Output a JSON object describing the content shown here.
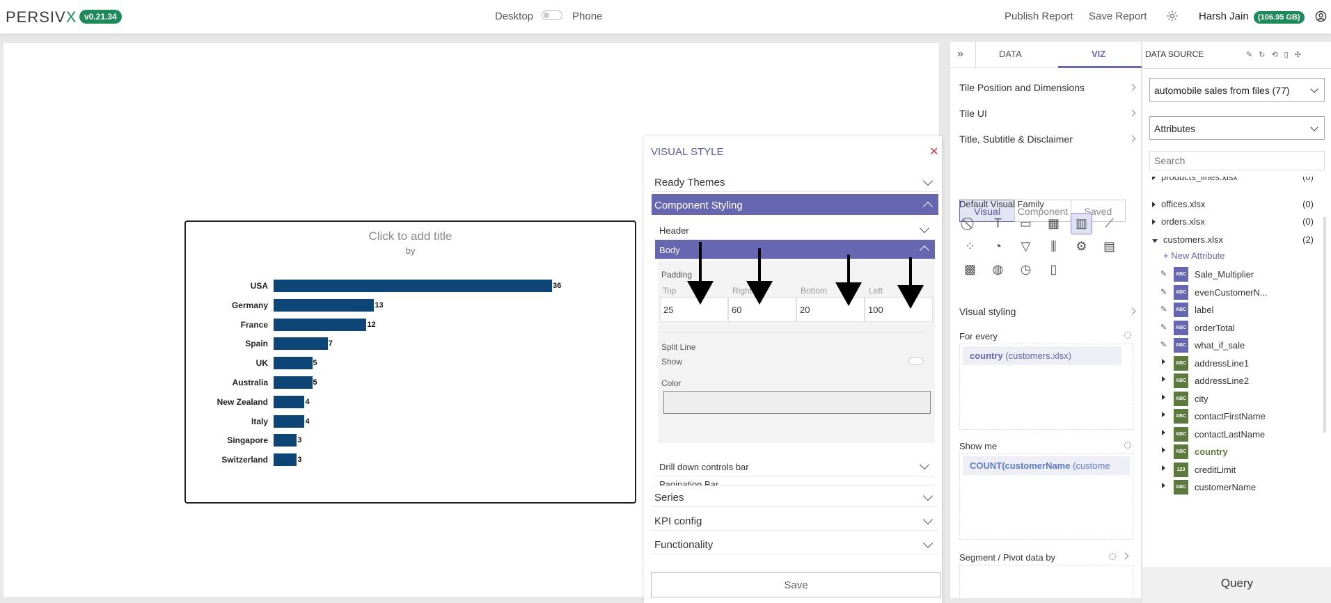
{
  "header": {
    "logo_main": "PERSIV",
    "logo_x": "X",
    "version": "v0.21.34",
    "desktop": "Desktop",
    "phone": "Phone",
    "publish": "Publish Report",
    "save": "Save Report",
    "user": "Harsh Jain",
    "storage": "(106.95 GB)"
  },
  "chart_data": {
    "type": "bar",
    "title": "Click to add title",
    "subtitle": "by",
    "categories": [
      "USA",
      "Germany",
      "France",
      "Spain",
      "UK",
      "Australia",
      "New Zealand",
      "Italy",
      "Singapore",
      "Switzerland"
    ],
    "values": [
      36,
      13,
      12,
      7,
      5,
      5,
      4,
      4,
      3,
      3
    ],
    "color": "#0d4577"
  },
  "visual_style": {
    "title": "VISUAL STYLE",
    "ready_themes": "Ready Themes",
    "component_styling": "Component Styling",
    "header": "Header",
    "body": "Body",
    "padding": "Padding",
    "top_label": "Top",
    "right_label": "Right",
    "bottom_label": "Bottom",
    "left_label": "Left",
    "top": "25",
    "right": "60",
    "bottom": "20",
    "left": "100",
    "split_line": "Split Line",
    "show": "Show",
    "color": "Color",
    "drill_down": "Drill down controls bar",
    "pagination": "Pagination Bar",
    "series": "Series",
    "kpi": "KPI config",
    "functionality": "Functionality",
    "save": "Save"
  },
  "viz_panel": {
    "tab_data": "DATA",
    "tab_viz": "VIZ",
    "tile_pos": "Tile Position and Dimensions",
    "tile_ui": "Tile UI",
    "title_sub": "Title, Subtitle & Disclaimer",
    "seg_visual": "Visual",
    "seg_component": "Component",
    "seg_saved": "Saved",
    "default_family": "Default Visual Family",
    "visual_styling": "Visual styling",
    "for_every": "For every",
    "for_every_field": "country",
    "for_every_src": "(customers.xlsx)",
    "show_me": "Show me",
    "show_me_field": "COUNT(customerName",
    "show_me_src": "(custome",
    "segment": "Segment / Pivot data by"
  },
  "data_source": {
    "title": "DATA SOURCE",
    "source": "automobile sales from files (77)",
    "attributes": "Attributes",
    "search_placeholder": "Search",
    "files": [
      {
        "name": "products_lines.xlsx",
        "count": "(0)"
      },
      {
        "name": "offices.xlsx",
        "count": "(0)"
      },
      {
        "name": "orders.xlsx",
        "count": "(0)"
      },
      {
        "name": "customers.xlsx",
        "count": "(2)"
      }
    ],
    "new_attr": "New Attribute",
    "attributes_list": [
      {
        "type": "ABC",
        "name": "Sale_Multiplier",
        "kind": "p"
      },
      {
        "type": "ABC",
        "name": "evenCustomerN...",
        "kind": "p"
      },
      {
        "type": "ABC",
        "name": "label",
        "kind": "p"
      },
      {
        "type": "ABC",
        "name": "orderTotal",
        "kind": "p"
      },
      {
        "type": "ABC",
        "name": "what_if_sale",
        "kind": "p"
      },
      {
        "type": "ABC",
        "name": "addressLine1",
        "kind": "g"
      },
      {
        "type": "ABC",
        "name": "addressLine2",
        "kind": "g"
      },
      {
        "type": "ABC",
        "name": "city",
        "kind": "g"
      },
      {
        "type": "ABC",
        "name": "contactFirstName",
        "kind": "g"
      },
      {
        "type": "ABC",
        "name": "contactLastName",
        "kind": "g"
      },
      {
        "type": "ABC",
        "name": "country",
        "kind": "g"
      },
      {
        "type": "123",
        "name": "creditLimit",
        "kind": "g"
      },
      {
        "type": "ABC",
        "name": "customerName",
        "kind": "g"
      }
    ],
    "query": "Query"
  }
}
